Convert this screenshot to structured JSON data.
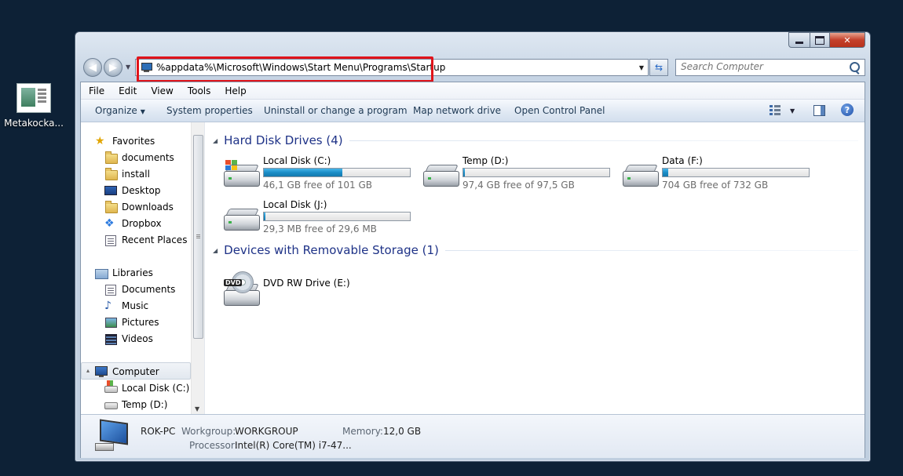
{
  "desktop": {
    "icon_label": "Metakocka..."
  },
  "window": {
    "address": {
      "path": "%appdata%\\Microsoft\\Windows\\Start Menu\\Programs\\Startup"
    },
    "search": {
      "placeholder": "Search Computer"
    },
    "menu": [
      "File",
      "Edit",
      "View",
      "Tools",
      "Help"
    ],
    "commands": {
      "organize": "Organize",
      "system_properties": "System properties",
      "uninstall": "Uninstall or change a program",
      "map_drive": "Map network drive",
      "control_panel": "Open Control Panel"
    },
    "nav": {
      "favorites": "Favorites",
      "fav_items": [
        "documents",
        "install",
        "Desktop",
        "Downloads",
        "Dropbox",
        "Recent Places"
      ],
      "libraries": "Libraries",
      "lib_items": [
        "Documents",
        "Music",
        "Pictures",
        "Videos"
      ],
      "computer": "Computer",
      "comp_items": [
        "Local Disk (C:)",
        "Temp (D:)"
      ]
    },
    "groups": {
      "hard_disks": "Hard Disk Drives (4)",
      "removable": "Devices with Removable Storage (1)"
    },
    "drives": [
      {
        "name": "Local Disk (C:)",
        "free": "46,1 GB free of 101 GB",
        "used_fraction": 0.54
      },
      {
        "name": "Temp (D:)",
        "free": "97,4 GB free of 97,5 GB",
        "used_fraction": 0.001
      },
      {
        "name": "Data (F:)",
        "free": "704 GB free of 732 GB",
        "used_fraction": 0.04
      },
      {
        "name": "Local Disk (J:)",
        "free": "29,3 MB free of 29,6 MB",
        "used_fraction": 0.01
      }
    ],
    "removable": [
      {
        "name": "DVD RW Drive (E:)",
        "badge": "DVD"
      }
    ],
    "details": {
      "pc_name": "ROK-PC",
      "workgroup_label": "Workgroup:",
      "workgroup_value": "WORKGROUP",
      "memory_label": "Memory:",
      "memory_value": "12,0 GB",
      "processor_label": "Processor:",
      "processor_value": "Intel(R) Core(TM) i7-47..."
    },
    "colors": {
      "highlight": "#e0141b",
      "group_heading": "#1e3287",
      "usage_bar": "#1b8dc7"
    }
  }
}
